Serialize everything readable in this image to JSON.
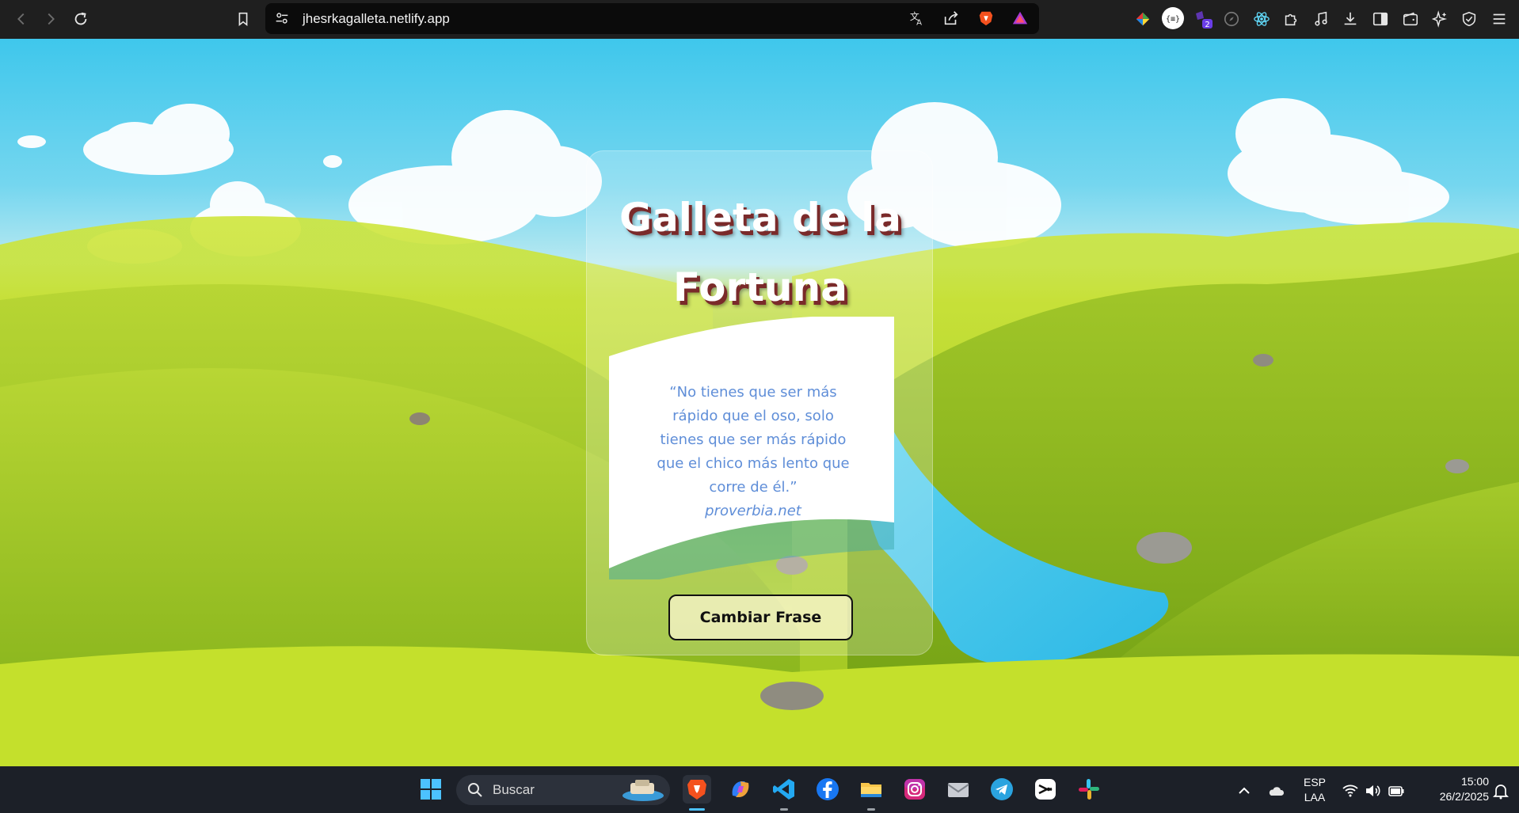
{
  "browser": {
    "url": "jhesrkagalleta.netlify.app",
    "extension_badge": "2",
    "toolbar_icons": [
      "back-icon",
      "forward-icon",
      "reload-icon",
      "bookmark-icon",
      "site-settings-icon",
      "translate-icon",
      "share-icon",
      "brave-shields-icon",
      "brave-rewards-icon",
      "color-picker-extension-icon",
      "json-extension-icon",
      "extension-badge-icon",
      "compass-icon",
      "react-devtools-icon",
      "extensions-icon",
      "media-icon",
      "downloads-icon",
      "sidebar-icon",
      "wallet-icon",
      "leo-ai-icon",
      "vpn-icon",
      "menu-icon"
    ]
  },
  "page": {
    "title": "Galleta de la Fortuna",
    "quote": "“No tienes que ser más rápido que el oso, solo tienes que ser más rápido que el chico más lento que corre de él.”",
    "author": "proverbia.net",
    "button_label": "Cambiar Frase",
    "colors": {
      "quote_text": "#5f8ed8",
      "title_shadow": "#7a2a2a",
      "paper": "#ffffff",
      "sky": "#3fc7ec",
      "grass": "#a7cc26"
    }
  },
  "taskbar": {
    "search_placeholder": "Buscar",
    "apps": [
      "windows-start-icon",
      "brave-icon",
      "copilot-icon",
      "vscode-icon",
      "facebook-icon",
      "file-explorer-icon",
      "instagram-icon",
      "mail-icon",
      "telegram-icon",
      "capcut-icon",
      "slack-icon"
    ],
    "tray": {
      "language_line1": "ESP",
      "language_line2": "LAA",
      "time": "15:00",
      "date": "26/2/2025"
    }
  }
}
